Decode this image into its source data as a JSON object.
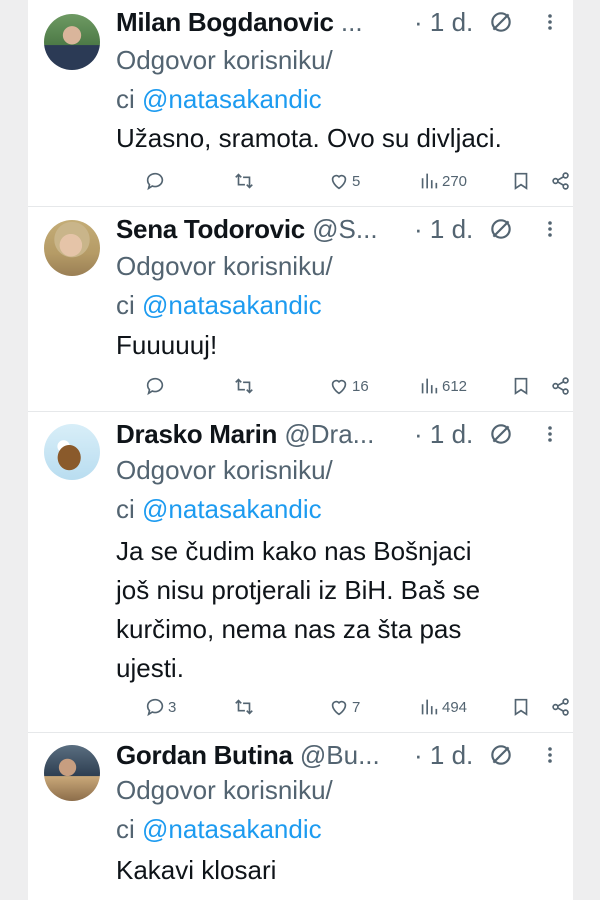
{
  "reply_prefix_line1": "Odgovor korisniku/",
  "reply_prefix_line2": "ci",
  "tweets": [
    {
      "name": "Milan Bogdanovic",
      "handle": "...",
      "time": "· 1 d.",
      "reply_to": "@natasakandic",
      "text": "Užasno, sramota. Ovo su divljaci.",
      "replies": "",
      "likes": "5",
      "views": "270"
    },
    {
      "name": "Sena Todorovic",
      "handle": "@S...",
      "time": "· 1 d.",
      "reply_to": "@natasakandic",
      "text": "Fuuuuuj!",
      "replies": "",
      "likes": "16",
      "views": "612"
    },
    {
      "name": "Drasko Marin",
      "handle": "@Dra...",
      "time": "· 1 d.",
      "reply_to": "@natasakandic",
      "text_lines": [
        "Ja se čudim kako nas Bošnjaci",
        "još nisu protjerali iz BiH. Baš se",
        "kurčimo, nema nas za šta pas",
        "ujesti."
      ],
      "replies": "3",
      "likes": "7",
      "views": "494"
    },
    {
      "name": "Gordan Butina",
      "handle": "@Bu...",
      "time": "· 1 d.",
      "reply_to": "@natasakandic",
      "text": "Kakavi klosari"
    }
  ],
  "icons": {
    "reply": "speech-bubble-icon",
    "retweet": "retweet-icon",
    "like": "heart-icon",
    "views": "bar-chart-icon",
    "bookmark": "bookmark-icon",
    "share": "share-icon",
    "more": "more-vertical-icon",
    "blocked": "no-entry-icon"
  },
  "colors": {
    "text": "#0f1419",
    "muted": "#536471",
    "link": "#1d9bf0"
  }
}
